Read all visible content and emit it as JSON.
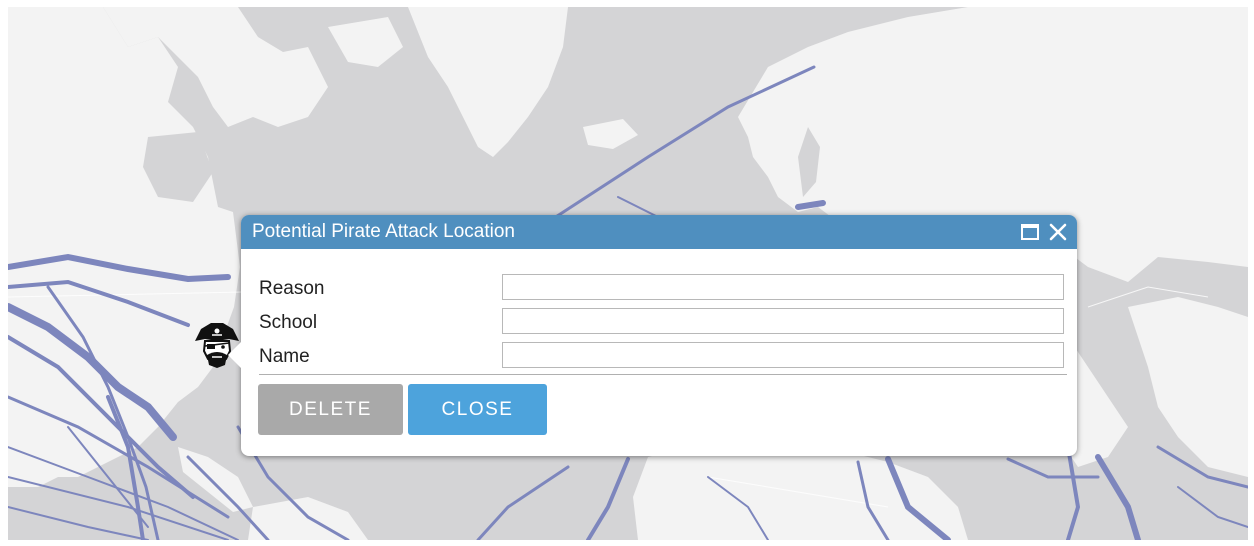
{
  "popup": {
    "title": "Potential Pirate Attack Location",
    "fields": [
      {
        "label": "Reason",
        "value": ""
      },
      {
        "label": "School",
        "value": ""
      },
      {
        "label": "Name",
        "value": ""
      }
    ],
    "delete_label": "DELETE",
    "close_label": "CLOSE"
  },
  "icons": {
    "maximize": "maximize-icon",
    "close": "close-icon",
    "marker": "pirate-marker-icon"
  },
  "colors": {
    "header": "#4f8fbf",
    "close_button": "#4da3dc",
    "delete_button": "#a9a9a9",
    "map_land": "#ffffff",
    "map_water": "#d4d4d6",
    "cables": "#7d86bd"
  }
}
